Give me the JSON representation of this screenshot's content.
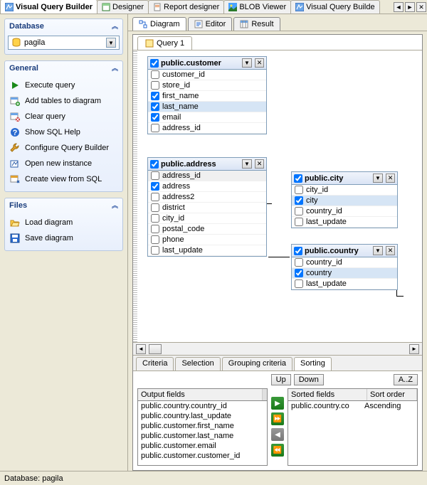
{
  "top_tabs": {
    "t0": "Visual Query Builder",
    "t1": "Designer",
    "t2": "Report designer",
    "t3": "BLOB Viewer",
    "t4": "Visual Query Builde"
  },
  "sidebar": {
    "database_header": "Database",
    "database_value": "pagila",
    "general_header": "General",
    "actions": {
      "exec": "Execute query",
      "add": "Add tables to diagram",
      "clear": "Clear query",
      "help": "Show SQL Help",
      "config": "Configure Query Builder",
      "open": "Open new instance",
      "create": "Create view from SQL"
    },
    "files_header": "Files",
    "files": {
      "load": "Load diagram",
      "save": "Save diagram"
    }
  },
  "subtabs": {
    "diagram": "Diagram",
    "editor": "Editor",
    "result": "Result"
  },
  "query_tab": "Query 1",
  "tables": {
    "customer": {
      "title": "public.customer",
      "cols": {
        "c0": "customer_id",
        "c1": "store_id",
        "c2": "first_name",
        "c3": "last_name",
        "c4": "email",
        "c5": "address_id"
      },
      "checked": [
        "first_name",
        "last_name",
        "email"
      ]
    },
    "address": {
      "title": "public.address",
      "cols": {
        "c0": "address_id",
        "c1": "address",
        "c2": "address2",
        "c3": "district",
        "c4": "city_id",
        "c5": "postal_code",
        "c6": "phone",
        "c7": "last_update"
      }
    },
    "city": {
      "title": "public.city",
      "cols": {
        "c0": "city_id",
        "c1": "city",
        "c2": "country_id",
        "c3": "last_update"
      }
    },
    "country": {
      "title": "public.country",
      "cols": {
        "c0": "country_id",
        "c1": "country",
        "c2": "last_update"
      }
    }
  },
  "bottom_tabs": {
    "criteria": "Criteria",
    "selection": "Selection",
    "grouping": "Grouping criteria",
    "sorting": "Sorting"
  },
  "sort": {
    "up": "Up",
    "down": "Down",
    "az": "A..Z",
    "out_header": "Output fields",
    "out": {
      "r0": "public.country.country_id",
      "r1": "public.country.last_update",
      "r2": "public.customer.first_name",
      "r3": "public.customer.last_name",
      "r4": "public.customer.email",
      "r5": "public.customer.customer_id"
    },
    "sorted_header": "Sorted fields",
    "order_header": "Sort order",
    "sorted_row": "public.country.co",
    "sorted_order": "Ascending"
  },
  "status": "Database: pagila"
}
